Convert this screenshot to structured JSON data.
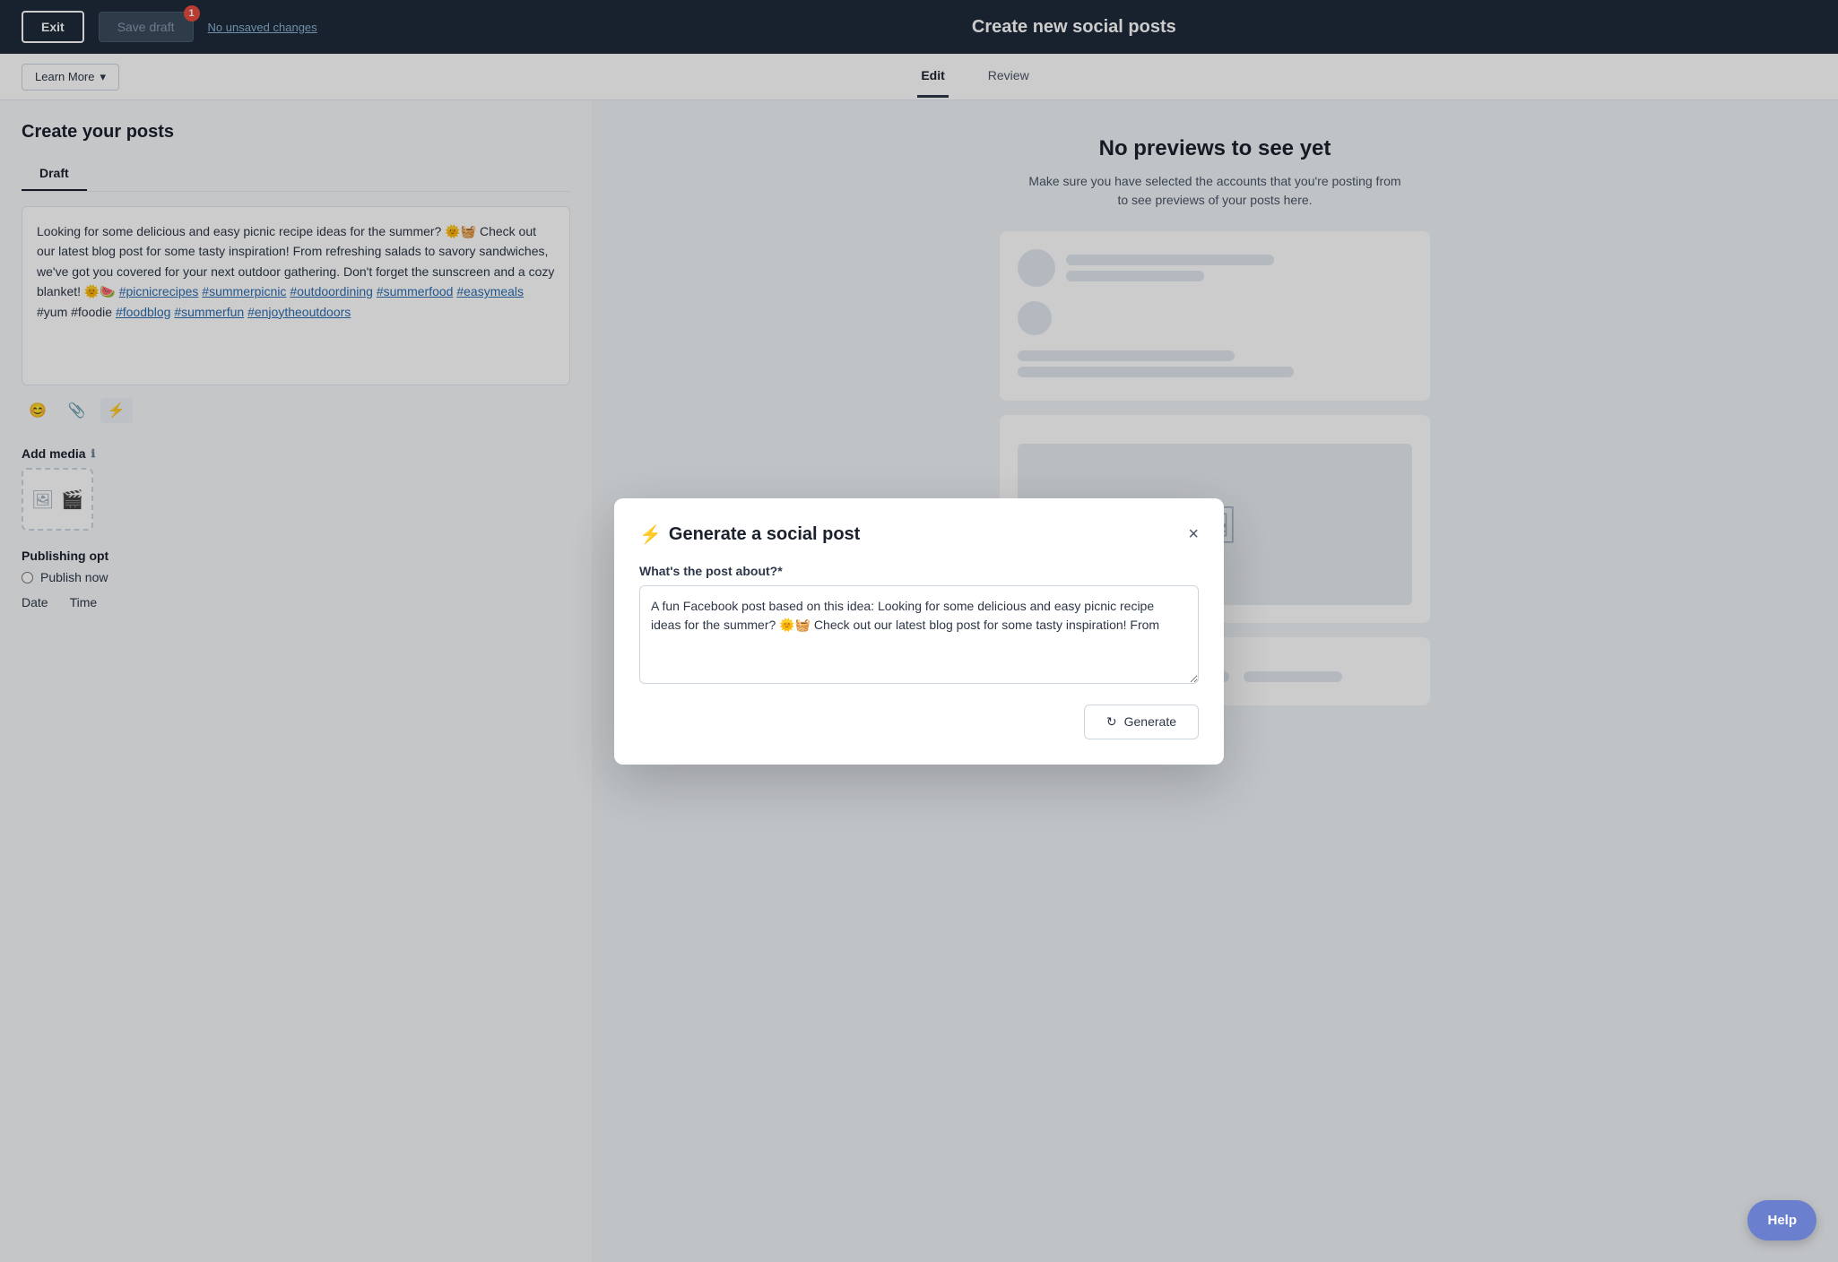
{
  "header": {
    "exit_label": "Exit",
    "save_draft_label": "Save draft",
    "badge_count": "1",
    "unsaved_label": "No unsaved changes",
    "page_title": "Create new social posts"
  },
  "subnav": {
    "learn_more_label": "Learn More",
    "chevron": "▾",
    "tabs": [
      {
        "id": "edit",
        "label": "Edit",
        "active": true
      },
      {
        "id": "review",
        "label": "Review",
        "active": false
      }
    ]
  },
  "left_panel": {
    "title": "Create your posts",
    "draft_tab": "Draft",
    "post_content": "Looking for some delicious and easy picnic recipe ideas for the summer? 🌞🧺 Check out our latest blog post for some tasty inspiration! From refreshing salads to savory sandwiches, we've got you covered for your next outdoor gathering. Don't forget the sunscreen and a cozy blanket! 🌞🍉 #picnicrecipes #summerpicnic #outdoordining #summerfood #easymeals #yum #foodie #foodblog #summerfun #enjoytheoutdoors",
    "toolbar": {
      "emoji_label": "😊",
      "attachment_label": "📎",
      "ai_label": "⚡"
    },
    "add_media": {
      "label": "Add media",
      "info_icon": "ℹ"
    },
    "publishing": {
      "label": "Publishing opt",
      "publish_now_label": "Publish now"
    },
    "date_label": "Date",
    "time_label": "Time"
  },
  "right_panel": {
    "no_preview_title": "No previews to see yet",
    "no_preview_desc": "Make sure you have selected the accounts that you're posting from to see previews of your posts here."
  },
  "modal": {
    "title": "Generate a social post",
    "lightning_icon": "⚡",
    "close_icon": "×",
    "question_label": "What's the post about?*",
    "textarea_value": "A fun Facebook post based on this idea: Looking for some delicious and easy picnic recipe ideas for the summer? 🌞🧺 Check out our latest blog post for some tasty inspiration! From",
    "generate_label": "Generate",
    "generate_icon": "↻"
  },
  "help": {
    "label": "Help"
  }
}
